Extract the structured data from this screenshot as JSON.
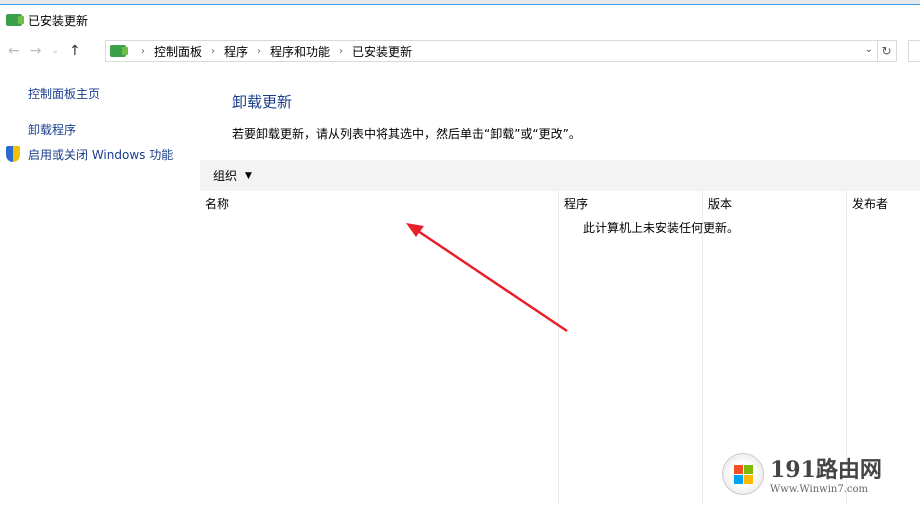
{
  "window": {
    "title": "已安装更新"
  },
  "breadcrumb": [
    "控制面板",
    "程序",
    "程序和功能",
    "已安装更新"
  ],
  "sidebar": {
    "items": [
      {
        "label": "控制面板主页"
      },
      {
        "label": "卸载程序"
      },
      {
        "label": "启用或关闭 Windows 功能"
      }
    ]
  },
  "main": {
    "title": "卸载更新",
    "description": "若要卸载更新，请从列表中将其选中，然后单击“卸载”或“更改”。",
    "organize_label": "组织",
    "columns": [
      "名称",
      "程序",
      "版本",
      "发布者"
    ],
    "empty_message": "此计算机上未安装任何更新。"
  },
  "watermark": {
    "text": "191路由网",
    "url": "Www.Winwin7.com"
  },
  "colors": {
    "link": "#1a3e8c",
    "arrow": "#e8202a"
  }
}
